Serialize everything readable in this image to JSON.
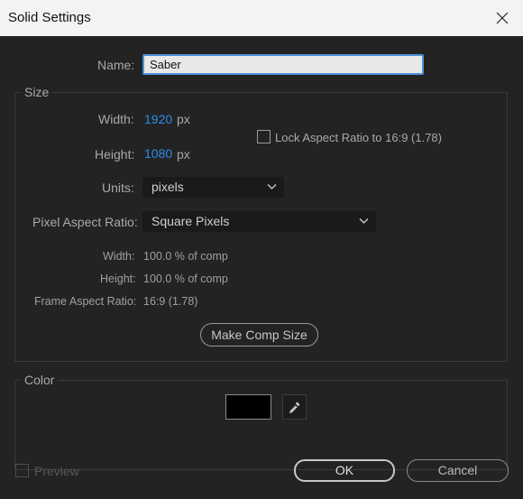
{
  "window": {
    "title": "Solid Settings"
  },
  "name": {
    "label": "Name:",
    "value": "Saber"
  },
  "size": {
    "group_title": "Size",
    "width_label": "Width:",
    "width_value": "1920",
    "height_label": "Height:",
    "height_value": "1080",
    "unit_px": "px",
    "lock_aspect_label": "Lock Aspect Ratio to 16:9 (1.78)",
    "lock_aspect_checked": false,
    "units_label": "Units:",
    "units_value": "pixels",
    "par_label": "Pixel Aspect Ratio:",
    "par_value": "Square Pixels",
    "info_width_label": "Width:",
    "info_width_value": "100.0 % of comp",
    "info_height_label": "Height:",
    "info_height_value": "100.0 % of comp",
    "info_far_label": "Frame Aspect Ratio:",
    "info_far_value": "16:9 (1.78)",
    "make_comp_size": "Make Comp Size"
  },
  "color": {
    "group_title": "Color",
    "swatch": "#000000"
  },
  "footer": {
    "preview_label": "Preview",
    "preview_checked": false,
    "ok_label": "OK",
    "cancel_label": "Cancel"
  }
}
